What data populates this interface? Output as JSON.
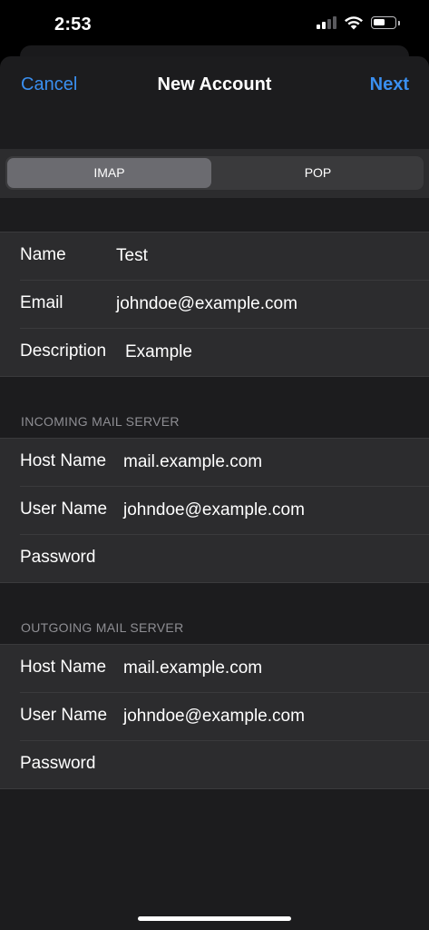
{
  "status_bar": {
    "time": "2:53",
    "signal_icon": "cellular-signal-icon",
    "wifi_icon": "wifi-icon",
    "battery_icon": "battery-icon",
    "battery_level": 0.55
  },
  "nav": {
    "cancel_label": "Cancel",
    "title": "New Account",
    "next_label": "Next",
    "accent_color": "#3a8ff0"
  },
  "account_type": {
    "options": [
      "IMAP",
      "POP"
    ],
    "selected": "IMAP"
  },
  "account": {
    "name_label": "Name",
    "name_value": "Test",
    "email_label": "Email",
    "email_value": "johndoe@example.com",
    "description_label": "Description",
    "description_value": "Example"
  },
  "incoming": {
    "header": "INCOMING MAIL SERVER",
    "host_label": "Host Name",
    "host_value": "mail.example.com",
    "user_label": "User Name",
    "user_value": "johndoe@example.com",
    "password_label": "Password",
    "password_value": ""
  },
  "outgoing": {
    "header": "OUTGOING MAIL SERVER",
    "host_label": "Host Name",
    "host_value": "mail.example.com",
    "user_label": "User Name",
    "user_value": "johndoe@example.com",
    "password_label": "Password",
    "password_value": ""
  }
}
